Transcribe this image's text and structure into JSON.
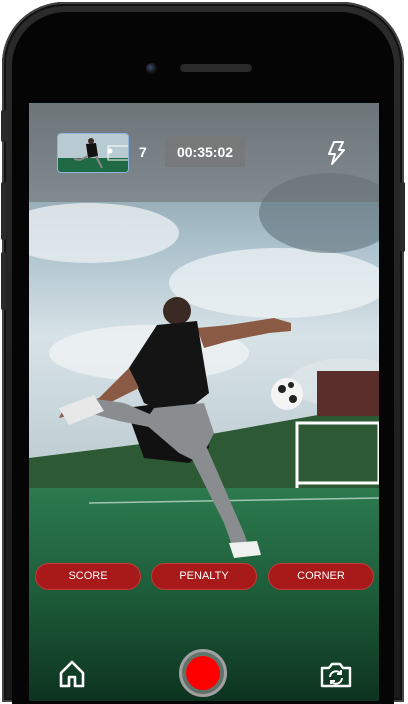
{
  "recording": {
    "clip_count": "7",
    "timer": "00:35:02"
  },
  "icons": {
    "flash": "flash-icon",
    "home": "home-icon",
    "record": "record-button",
    "switch_camera": "switch-camera-icon"
  },
  "event_buttons": [
    {
      "label": "SCORE"
    },
    {
      "label": "PENALTY"
    },
    {
      "label": "CORNER"
    }
  ],
  "colors": {
    "event_button": "#a8191a",
    "record": "#ff0000"
  }
}
